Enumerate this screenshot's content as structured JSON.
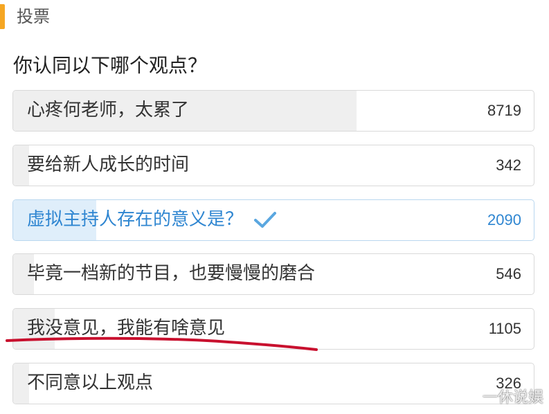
{
  "header": {
    "title": "投票",
    "accent_color": "#f5a623"
  },
  "poll": {
    "question": "你认同以下哪个观点？",
    "options": [
      {
        "label": "心疼何老师，太累了",
        "count": "8719",
        "share": 0.66,
        "selected": false
      },
      {
        "label": "要给新人成长的时间",
        "count": "342",
        "share": 0.03,
        "selected": false
      },
      {
        "label": "虚拟主持人存在的意义是？",
        "count": "2090",
        "share": 0.16,
        "selected": true,
        "icon": "checkmark-icon"
      },
      {
        "label": "毕竟一档新的节目，也要慢慢的磨合",
        "count": "546",
        "share": 0.04,
        "selected": false
      },
      {
        "label": "我没意见，我能有啥意见",
        "count": "1105",
        "share": 0.08,
        "selected": false
      },
      {
        "label": "不同意以上观点",
        "count": "326",
        "share": 0.03,
        "selected": false
      }
    ],
    "selected_color": "#2f86d1",
    "underline_color": "#c8102e"
  },
  "watermark": {
    "text": "一休说娱"
  }
}
